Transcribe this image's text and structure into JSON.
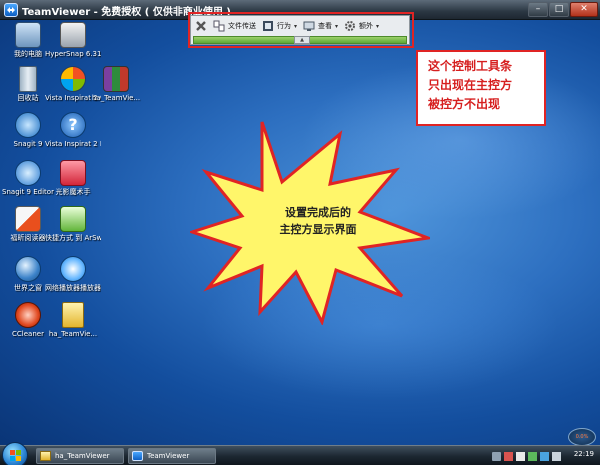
{
  "window": {
    "title": "TeamViewer - 免费授权 ( 仅供非商业使用 )",
    "controls": {
      "minimize": "–",
      "maximize": "□",
      "close": "✕"
    }
  },
  "toolbar": {
    "close_icon": "x-icon",
    "items": [
      {
        "label": "文件传送",
        "icon": "file-transfer-icon",
        "dropdown": false
      },
      {
        "label": "行为",
        "icon": "action-icon",
        "dropdown": true
      },
      {
        "label": "查看",
        "icon": "view-icon",
        "dropdown": true
      },
      {
        "label": "额外",
        "icon": "gear-icon",
        "dropdown": true
      }
    ],
    "dropdown_glyph": "▾",
    "grip_glyph": "▲"
  },
  "desktop_icons": [
    {
      "label": "我的电脑"
    },
    {
      "label": "HyperSnap 6.31.01 免..."
    },
    {
      "label": "回收站"
    },
    {
      "label": "Vista Inspirat 2 Config"
    },
    {
      "label": "ha_TeamVie..."
    },
    {
      "label": "Snagit 9"
    },
    {
      "label": "Vista Inspirat 2 Help"
    },
    {
      "label": "Snagit 9 Editor"
    },
    {
      "label": "光影魔术手"
    },
    {
      "label": "福昕阅读器"
    },
    {
      "label": "快捷方式 到 ArSwp"
    },
    {
      "label": "世界之窗"
    },
    {
      "label": "网络播放器播放器"
    },
    {
      "label": "CCleaner"
    },
    {
      "label": "ha_TeamVie..."
    }
  ],
  "callout": {
    "lines": [
      "这个控制工具条",
      "只出现在主控方",
      "被控方不出现"
    ]
  },
  "burst": {
    "lines": [
      "设置完成后的",
      "主控方显示界面"
    ]
  },
  "taskbar": {
    "tasks": [
      {
        "label": "ha_TeamViewer"
      },
      {
        "label": "TeamViewer"
      }
    ],
    "clock": "22:19",
    "cpu_label": "0.0%"
  },
  "colors": {
    "highlight": "#e02424",
    "callout_text": "#d61f1f",
    "burst_fill": "#fff66a",
    "toolbar_green": "#5fa935"
  }
}
